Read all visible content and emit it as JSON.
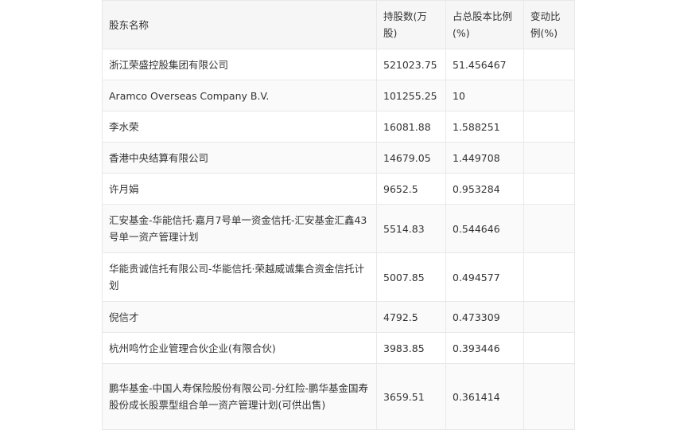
{
  "table": {
    "headers": [
      "股东名称",
      "持股数(万股)",
      "占总股本比例(%)",
      "变动比例(%)"
    ],
    "rows": [
      {
        "name": "浙江荣盛控股集团有限公司",
        "shares": "521023.75",
        "ratio": "51.456467",
        "change": ""
      },
      {
        "name": "Aramco Overseas Company B.V.",
        "shares": "101255.25",
        "ratio": "10",
        "change": ""
      },
      {
        "name": "李水荣",
        "shares": "16081.88",
        "ratio": "1.588251",
        "change": ""
      },
      {
        "name": "香港中央结算有限公司",
        "shares": "14679.05",
        "ratio": "1.449708",
        "change": ""
      },
      {
        "name": "许月娟",
        "shares": "9652.5",
        "ratio": "0.953284",
        "change": ""
      },
      {
        "name": "汇安基金-华能信托·嘉月7号单一资金信托-汇安基金汇鑫43号单一资产管理计划",
        "shares": "5514.83",
        "ratio": "0.544646",
        "change": ""
      },
      {
        "name": "华能贵诚信托有限公司-华能信托·荣越威诚集合资金信托计划",
        "shares": "5007.85",
        "ratio": "0.494577",
        "change": ""
      },
      {
        "name": "倪信才",
        "shares": "4792.5",
        "ratio": "0.473309",
        "change": ""
      },
      {
        "name": "杭州鸣竹企业管理合伙企业(有限合伙)",
        "shares": "3983.85",
        "ratio": "0.393446",
        "change": ""
      },
      {
        "name": "鹏华基金-中国人寿保险股份有限公司-分红险-鹏华基金国寿股份成长股票型组合单一资产管理计划(可供出售)",
        "shares": "3659.51",
        "ratio": "0.361414",
        "change": ""
      }
    ]
  }
}
